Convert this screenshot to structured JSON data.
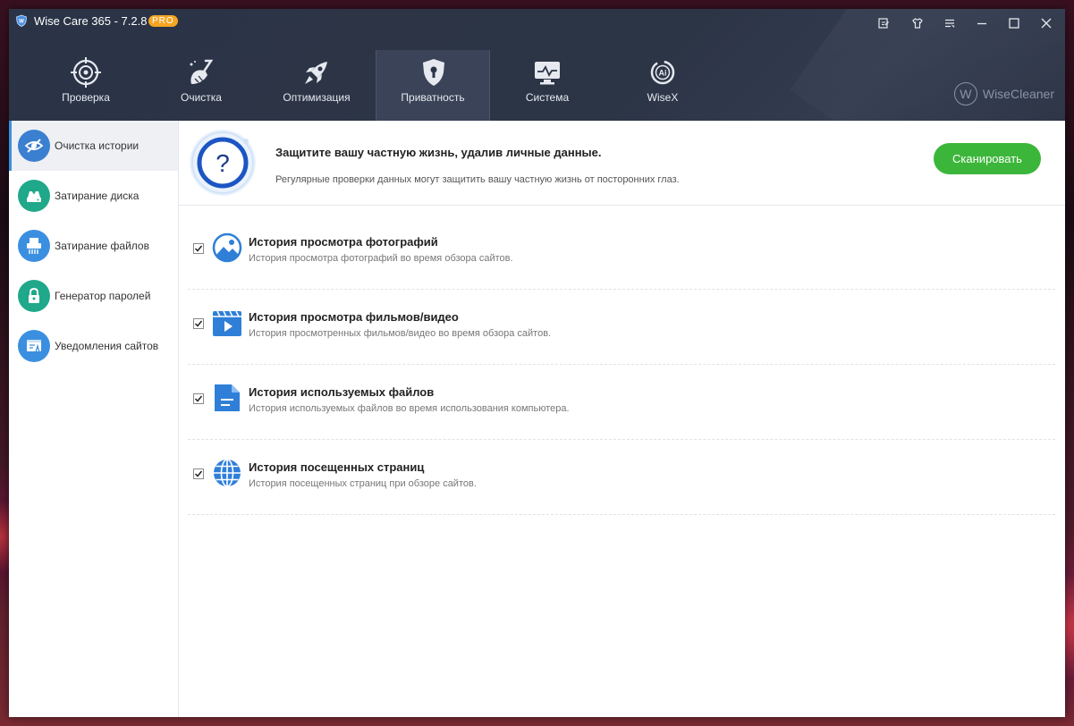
{
  "app": {
    "title": "Wise Care 365 - 7.2.8",
    "badge": "PRO",
    "brand": "WiseCleaner",
    "brand_letter": "W"
  },
  "nav": {
    "tabs": [
      {
        "label": "Проверка",
        "icon": "target-icon"
      },
      {
        "label": "Очистка",
        "icon": "broom-icon"
      },
      {
        "label": "Оптимизация",
        "icon": "rocket-icon"
      },
      {
        "label": "Приватность",
        "icon": "shield-lock-icon",
        "active": true
      },
      {
        "label": "Система",
        "icon": "monitor-icon"
      },
      {
        "label": "WiseX",
        "icon": "ai-icon"
      }
    ]
  },
  "sidebar": {
    "items": [
      {
        "label": "Очистка истории",
        "icon": "eye-off-icon",
        "color": "#3b7fd0",
        "active": true
      },
      {
        "label": "Затирание диска",
        "icon": "disk-icon",
        "color": "#1fa88a"
      },
      {
        "label": "Затирание файлов",
        "icon": "shredder-icon",
        "color": "#3b8fe0"
      },
      {
        "label": "Генератор паролей",
        "icon": "lock-icon",
        "color": "#1fa88a"
      },
      {
        "label": "Уведомления сайтов",
        "icon": "notification-icon",
        "color": "#3b8fe0"
      }
    ]
  },
  "banner": {
    "title": "Защитите вашу частную жизнь, удалив личные данные.",
    "subtitle": "Регулярные проверки данных могут защитить вашу частную жизнь от посторонних глаз.",
    "scan_label": "Сканировать",
    "icon": "question-icon"
  },
  "items": [
    {
      "title": "История просмотра фотографий",
      "desc": "История просмотра фотографий во время обзора сайтов.",
      "checked": true,
      "icon": "photo-icon"
    },
    {
      "title": "История просмотра фильмов/видео",
      "desc": "История просмотренных фильмов/видео во время обзора сайтов.",
      "checked": true,
      "icon": "video-icon"
    },
    {
      "title": "История используемых файлов",
      "desc": "История используемых файлов во время использования компьютера.",
      "checked": true,
      "icon": "file-icon"
    },
    {
      "title": "История посещенных страниц",
      "desc": "История посещенных страниц при обзоре сайтов.",
      "checked": true,
      "icon": "globe-icon"
    }
  ],
  "colors": {
    "accent": "#3b8fe0",
    "scan_button": "#3cb63a",
    "header_bg": "#2b3447"
  }
}
